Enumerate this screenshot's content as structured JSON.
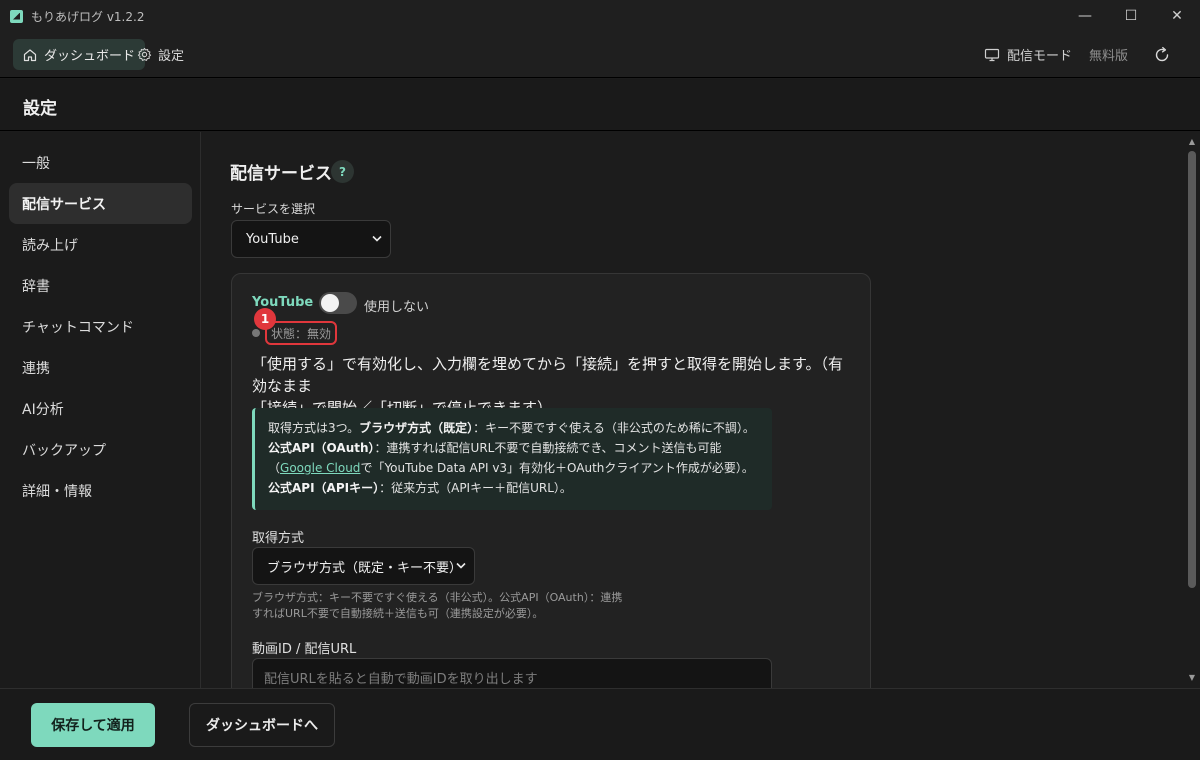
{
  "window": {
    "title": "もりあげログ v1.2.2",
    "controls": {
      "minimize": "—",
      "maximize": "☐",
      "close": "✕"
    }
  },
  "topnav": {
    "dashboard": "ダッシュボード",
    "settings": "設定",
    "broadcast_mode": "配信モード",
    "free_edition": "無料版"
  },
  "page": {
    "title": "設定"
  },
  "sidebar": {
    "items": [
      {
        "label": "一般"
      },
      {
        "label": "配信サービス"
      },
      {
        "label": "読み上げ"
      },
      {
        "label": "辞書"
      },
      {
        "label": "チャットコマンド"
      },
      {
        "label": "連携"
      },
      {
        "label": "AI分析"
      },
      {
        "label": "バックアップ"
      },
      {
        "label": "詳細・情報"
      }
    ],
    "active_index": 1
  },
  "main": {
    "section_title": "配信サービス",
    "help": "?",
    "service_label": "サービスを選択",
    "service_value": "YouTube",
    "card": {
      "service_name": "YouTube",
      "toggle_label": "使用しない",
      "toggle_on": false,
      "status": "状態：無効",
      "badge": "1",
      "description_line1": "「使用する」で有効化し、入力欄を埋めてから「接続」を押すと取得を開始します。（有効なまま",
      "description_line2": "「接続」で開始／「切断」で停止できます）",
      "info": {
        "t1": "取得方式は3つ。",
        "b1": "ブラウザ方式（既定）",
        "t2": "：キー不要ですぐ使える（非公式のため稀に不調）。",
        "b2": "公式API（OAuth）",
        "t3": "：連携すれば配信URL不要で自動接続でき、コメント送信も可能（",
        "link": "Google Cloud",
        "t4": "で「YouTube Data API v3」有効化＋OAuthクライアント作成が必要）。",
        "b3": "公式API（APIキー）",
        "t5": "：従来方式（APIキー＋配信URL）。"
      },
      "method_label": "取得方式",
      "method_value": "ブラウザ方式（既定・キー不要）",
      "method_hint_line1": "ブラウザ方式：キー不要ですぐ使える（非公式）。公式API（OAuth）：連携",
      "method_hint_line2": "すればURL不要で自動接続＋送信も可（連携設定が必要）。",
      "video_label": "動画ID / 配信URL",
      "video_placeholder": "配信URLを貼ると自動で動画IDを取り出します"
    }
  },
  "footer": {
    "save": "保存して適用",
    "to_dashboard": "ダッシュボードへ"
  },
  "colors": {
    "accent": "#7ed9bd",
    "alert": "#e0373c"
  }
}
